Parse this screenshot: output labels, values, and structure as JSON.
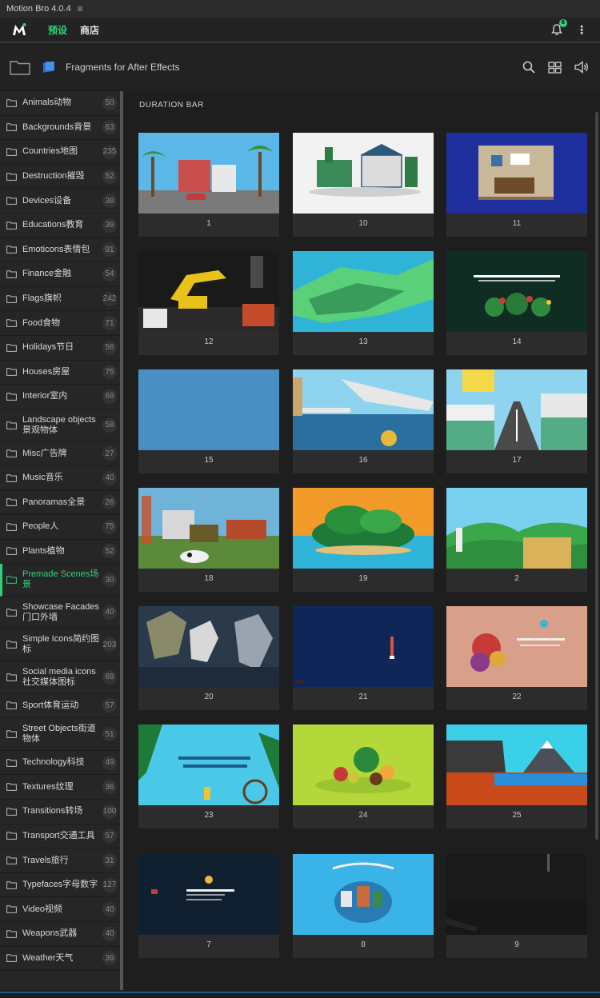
{
  "app": {
    "title": "Motion Bro 4.0.4",
    "menu_icon": "hamburger-icon"
  },
  "topbar": {
    "tabs": [
      {
        "label": "预设",
        "active": true
      },
      {
        "label": "商店",
        "active": false
      }
    ],
    "notification_count": "6",
    "accent": "#2fd07a"
  },
  "pack": {
    "name": "Fragments for After Effects"
  },
  "section": {
    "title": "DURATION BAR"
  },
  "sidebar": {
    "items": [
      {
        "label": "Animals动物",
        "count": "50"
      },
      {
        "label": "Backgrounds背景",
        "count": "63"
      },
      {
        "label": "Countries地图",
        "count": "235"
      },
      {
        "label": "Destruction摧毁",
        "count": "52"
      },
      {
        "label": "Devices设备",
        "count": "38"
      },
      {
        "label": "Educations教育",
        "count": "39"
      },
      {
        "label": "Emoticons表情包",
        "count": "91"
      },
      {
        "label": "Finance金融",
        "count": "54"
      },
      {
        "label": "Flags旗帜",
        "count": "242"
      },
      {
        "label": "Food食物",
        "count": "71"
      },
      {
        "label": "Holidays节日",
        "count": "56"
      },
      {
        "label": "Houses房屋",
        "count": "75"
      },
      {
        "label": "Interior室内",
        "count": "69"
      },
      {
        "label": "Landscape objects景观物体",
        "count": "58"
      },
      {
        "label": "Misc广告牌",
        "count": "27"
      },
      {
        "label": "Music音乐",
        "count": "40"
      },
      {
        "label": "Panoramas全景",
        "count": "26"
      },
      {
        "label": "People人",
        "count": "75"
      },
      {
        "label": "Plants植物",
        "count": "52"
      },
      {
        "label": "Premade Scenes场景",
        "count": "30",
        "active": true
      },
      {
        "label": "Showcase Facades门口外墙",
        "count": "40"
      },
      {
        "label": "Simple Icons简约图标",
        "count": "203"
      },
      {
        "label": "Social media icons社交媒体图标",
        "count": "69"
      },
      {
        "label": "Sport体育运动",
        "count": "57"
      },
      {
        "label": "Street Objects街道物体",
        "count": "51"
      },
      {
        "label": "Technology科技",
        "count": "49"
      },
      {
        "label": "Textures纹理",
        "count": "36"
      },
      {
        "label": "Transitions转场",
        "count": "100"
      },
      {
        "label": "Transport交通工具",
        "count": "57"
      },
      {
        "label": "Travels旅行",
        "count": "31"
      },
      {
        "label": "Typefaces字母数字",
        "count": "127"
      },
      {
        "label": "Video视频",
        "count": "40"
      },
      {
        "label": "Weapons武器",
        "count": "40"
      },
      {
        "label": "Weather天气",
        "count": "39"
      }
    ]
  },
  "presets": [
    {
      "label": "1",
      "theme": "street-palms",
      "colors": [
        "#5bb7e8",
        "#3b8f3a",
        "#c94f4f"
      ]
    },
    {
      "label": "10",
      "theme": "town-white",
      "colors": [
        "#f2f2f2",
        "#2e7d46",
        "#3a6fa8"
      ]
    },
    {
      "label": "11",
      "theme": "room-blue",
      "colors": [
        "#1f2f9e",
        "#c9b89a",
        "#6d4a2a"
      ]
    },
    {
      "label": "12",
      "theme": "construction-night",
      "colors": [
        "#1a1a1a",
        "#e8c21b",
        "#c44b2a"
      ]
    },
    {
      "label": "13",
      "theme": "map-teal",
      "colors": [
        "#2fb4d8",
        "#5bd07a",
        "#3a9c5a"
      ]
    },
    {
      "label": "14",
      "theme": "flower-shop",
      "colors": [
        "#0f2d22",
        "#c83c3c",
        "#2e8b3e"
      ]
    },
    {
      "label": "15",
      "theme": "plain-blue",
      "colors": [
        "#4a8fc4",
        "#4a8fc4",
        "#4a8fc4"
      ]
    },
    {
      "label": "16",
      "theme": "cruise-ship",
      "colors": [
        "#8fd4ef",
        "#2a6f9e",
        "#e7e7e7"
      ]
    },
    {
      "label": "17",
      "theme": "city-road",
      "colors": [
        "#f5d84a",
        "#4a4a4a",
        "#3a9c5a"
      ]
    },
    {
      "label": "18",
      "theme": "farm-construction",
      "colors": [
        "#6fb4d8",
        "#c94f2a",
        "#3a8c3a"
      ]
    },
    {
      "label": "19",
      "theme": "tropical-island",
      "colors": [
        "#f29a2a",
        "#1f7a3a",
        "#2fb4d8"
      ]
    },
    {
      "label": "2",
      "theme": "hills-castle",
      "colors": [
        "#7ad0ef",
        "#3aa84a",
        "#d9b25a"
      ]
    },
    {
      "label": "20",
      "theme": "mech-battle",
      "colors": [
        "#2a3a4a",
        "#8a8a6a",
        "#d8d8d8"
      ]
    },
    {
      "label": "21",
      "theme": "navy-rocket",
      "colors": [
        "#0f2659",
        "#d8553a",
        "#f0f0f0"
      ]
    },
    {
      "label": "22",
      "theme": "food-peach",
      "colors": [
        "#d8a08a",
        "#c83a3a",
        "#3ab4d8"
      ]
    },
    {
      "label": "23",
      "theme": "travel-pool",
      "colors": [
        "#4ac8e8",
        "#1f7a3a",
        "#f0f0f0"
      ]
    },
    {
      "label": "24",
      "theme": "fruits-lime",
      "colors": [
        "#b4d83a",
        "#c83a3a",
        "#2a8a3a"
      ]
    },
    {
      "label": "25",
      "theme": "cliff-mountain",
      "colors": [
        "#3ad0e8",
        "#c84a1a",
        "#3a3a3a"
      ]
    },
    {
      "label": "7",
      "theme": "dark-program",
      "colors": [
        "#0f1f2f",
        "#f0f0f0",
        "#c83a3a"
      ]
    },
    {
      "label": "8",
      "theme": "online-food",
      "colors": [
        "#3ab4e8",
        "#f0f0f0",
        "#c86a3a"
      ]
    },
    {
      "label": "9",
      "theme": "dark-weapon",
      "colors": [
        "#1a1a1a",
        "#3a3a3a",
        "#5a5a5a"
      ]
    }
  ]
}
